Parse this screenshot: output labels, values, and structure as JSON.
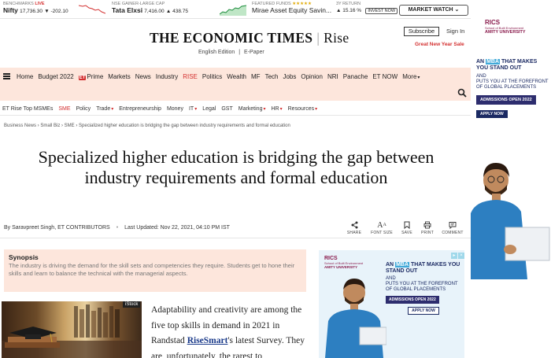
{
  "ticker": {
    "nifty": {
      "label": "BENCHMARKS",
      "live": "LIVE",
      "name": "Nifty",
      "value": "17,736.30",
      "change": "▼ -202.10"
    },
    "tata": {
      "label": "NSE GAINER-LARGE CAP",
      "name": "Tata Elxsi",
      "value": "7,416.00",
      "change": "▲ 438.75"
    },
    "fund": {
      "label": "FEATURED FUNDS",
      "stars": "★★★★★",
      "name": "Mirae Asset Equity Savin...",
      "return_label": "3Y RETURN",
      "return_value": "▲ 15.16 %",
      "invest": "INVEST NOW"
    },
    "market_watch": "MARKET WATCH ⌄"
  },
  "masthead": {
    "logo_main": "THE ECONOMIC TIMES",
    "logo_rise": "Rise",
    "edition": "English Edition",
    "edition_sep": "|",
    "epaper": "E-Paper",
    "subscribe": "Subscribe",
    "signin": "Sign In",
    "sale": "Great New Year Sale"
  },
  "nav": {
    "items": [
      "Home",
      "Budget 2022",
      "ETPrime",
      "Markets",
      "News",
      "Industry",
      "RISE",
      "Politics",
      "Wealth",
      "MF",
      "Tech",
      "Jobs",
      "Opinion",
      "NRI",
      "Panache",
      "ET NOW",
      "More"
    ],
    "etprime_badge": "ET",
    "etprime_text": "Prime"
  },
  "subnav": {
    "items": [
      {
        "label": "ET Rise Top MSMEs",
        "caret": ""
      },
      {
        "label": "SME",
        "caret": ""
      },
      {
        "label": "Policy",
        "caret": ""
      },
      {
        "label": "Trade",
        "caret": "▾"
      },
      {
        "label": "Entrepreneurship",
        "caret": ""
      },
      {
        "label": "Money",
        "caret": ""
      },
      {
        "label": "IT",
        "caret": "▾"
      },
      {
        "label": "Legal",
        "caret": ""
      },
      {
        "label": "GST",
        "caret": ""
      },
      {
        "label": "Marketing",
        "caret": "▾"
      },
      {
        "label": "HR",
        "caret": "▾"
      },
      {
        "label": "Resources",
        "caret": "▾"
      }
    ]
  },
  "breadcrumb": "Business News › Small Biz › SME › Specialized higher education is bridging the gap between industry requirements and formal education",
  "article": {
    "headline": "Specialized higher education is bridging the gap between industry requirements and formal education",
    "byline": "By Saravpreet Singh, ET CONTRIBUTORS",
    "bullet": "•",
    "updated": "Last Updated: Nov 22, 2021, 04:10 PM IST",
    "tools": [
      "SHARE",
      "FONT SIZE",
      "SAVE",
      "PRINT",
      "COMMENT"
    ],
    "synopsis_title": "Synopsis",
    "synopsis_text": "The industry is driving the demand for the skill sets and competencies they require. Students get to hone their skills and learn to balance the technical with the managerial aspects.",
    "image_credit": "iStock",
    "body_before": "Adaptability and creativity are among the five top skills in demand in 2021 in Randstad ",
    "body_link": "RiseSmart",
    "body_after": "'s latest Survey. They are, unfortunately, the rarest to"
  },
  "ad": {
    "brand": "RICS",
    "school": "School of Built Environment",
    "university": "AMITY UNIVERSITY",
    "headline_pre": "AN ",
    "headline_mba": "MBA",
    "headline_post": " THAT MAKES YOU STAND OUT",
    "sub1": "AND",
    "sub2": "PUTS YOU AT THE FOREFRONT OF GLOBAL PLACEMENTS",
    "admissions": "ADMISSIONS OPEN 2022",
    "apply": "APPLY NOW"
  },
  "colors": {
    "accent": "#d32f2f",
    "nav_bg": "#fde6dc",
    "ad_navy": "#1b2a63",
    "ad_blue": "#3ea8d8"
  }
}
